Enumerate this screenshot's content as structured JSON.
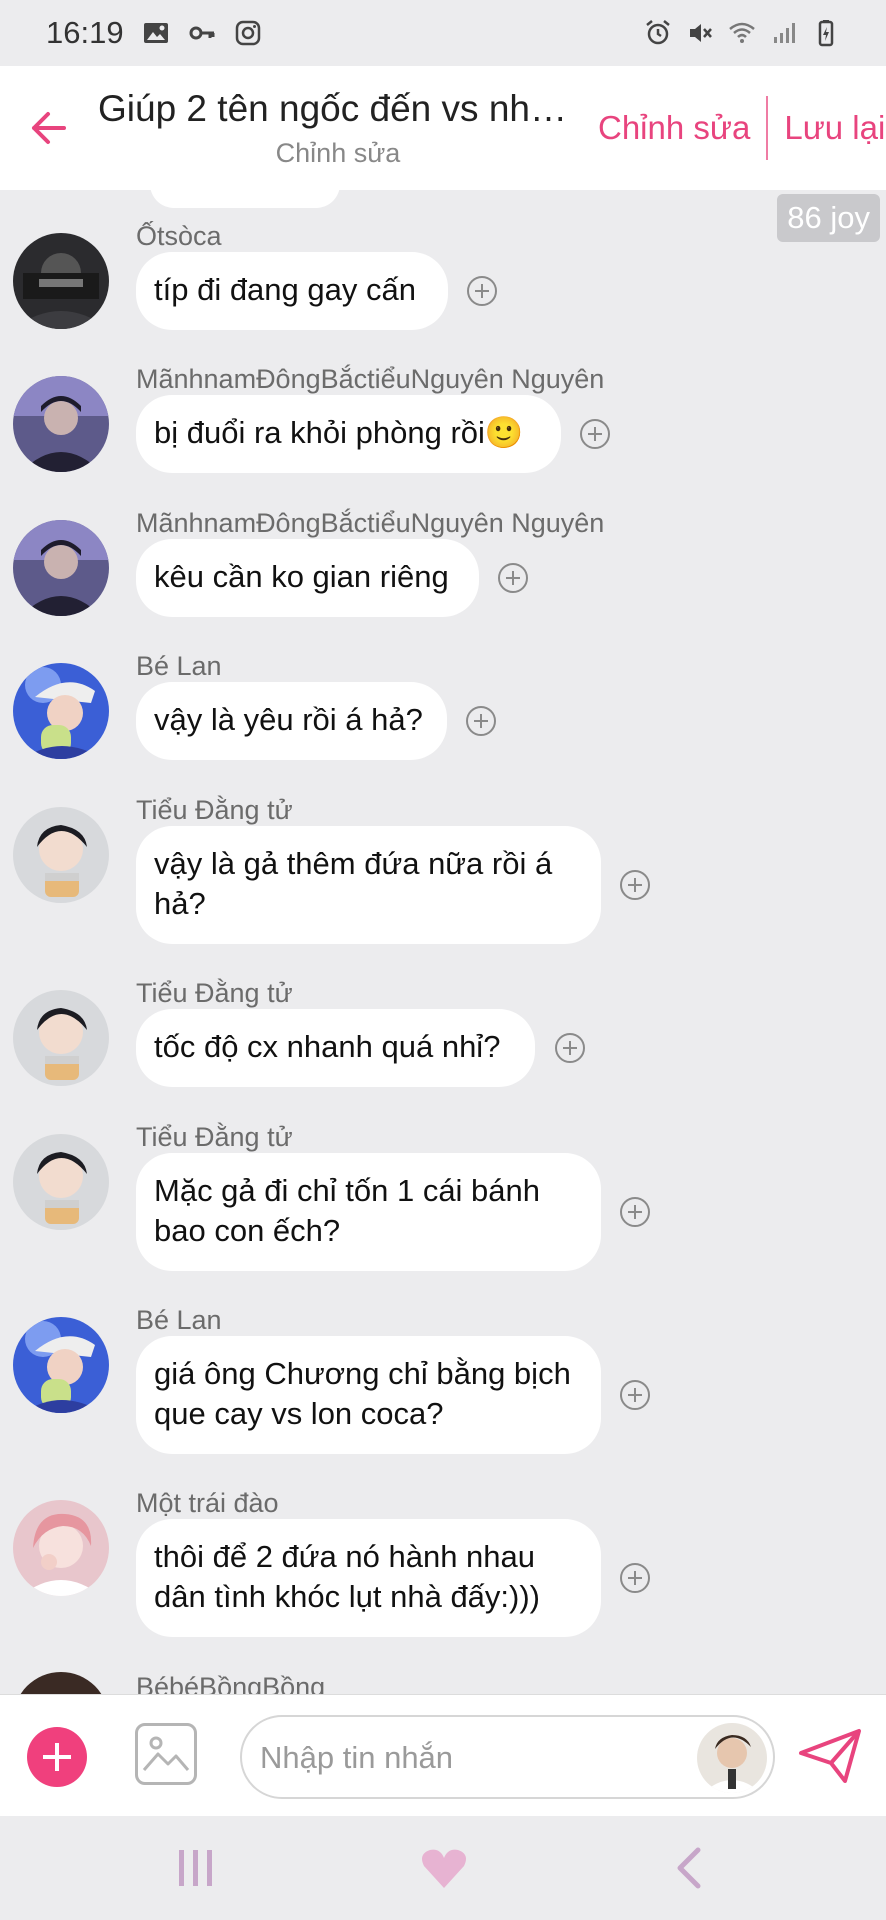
{
  "status_bar": {
    "time": "16:19",
    "left_icons": [
      "image-icon",
      "key-icon",
      "instagram-icon"
    ],
    "right_icons": [
      "alarm-icon",
      "mute-icon",
      "wifi-icon",
      "signal-icon",
      "battery-icon"
    ]
  },
  "header": {
    "title": "Giúp 2 tên ngốc đến vs nha...",
    "subtitle": "Chỉnh sửa",
    "edit_label": "Chỉnh sửa",
    "save_label": "Lưu lại"
  },
  "joy_badge": "86 joy",
  "messages": [
    {
      "sender": "Ốtsòca",
      "text": "típ đi đang gay cấn",
      "avatar": "dark"
    },
    {
      "sender": "MãnhnamĐôngBắctiểuNguyên Nguyên",
      "text": "bị đuổi ra khỏi phòng rồi🙂",
      "avatar": "purple"
    },
    {
      "sender": "MãnhnamĐôngBắctiểuNguyên Nguyên",
      "text": "kêu cần ko gian riêng",
      "avatar": "purple"
    },
    {
      "sender": "Bé Lan",
      "text": "vậy là yêu rồi á hả?",
      "avatar": "blue"
    },
    {
      "sender": "Tiểu Đằng tử",
      "text": "vậy là gả thêm đứa nữa rồi á hả?",
      "avatar": "gray"
    },
    {
      "sender": "Tiểu Đằng tử",
      "text": "tốc độ cx nhanh quá nhỉ?",
      "avatar": "gray"
    },
    {
      "sender": "Tiểu Đằng tử",
      "text": "Mặc gả đi chỉ tốn 1 cái bánh bao con ếch?",
      "avatar": "gray"
    },
    {
      "sender": "Bé Lan",
      "text": "giá ông Chương chỉ bằng bịch que cay vs lon coca?",
      "avatar": "blue"
    },
    {
      "sender": "Một trái đào",
      "text": "thôi để 2 đứa nó hành nhau dân tình khóc lụt nhà đấy:)))",
      "avatar": "pink"
    },
    {
      "sender": "BébéBồngBồng",
      "text": "",
      "avatar": "dark"
    }
  ],
  "input": {
    "placeholder": "Nhập tin nhắn"
  },
  "nav": [
    "recent-apps-icon",
    "heart-home-icon",
    "back-icon"
  ],
  "colors": {
    "accent": "#e8447e",
    "add_button": "#f0407d",
    "background": "#ececee",
    "bubble": "#ffffff"
  }
}
